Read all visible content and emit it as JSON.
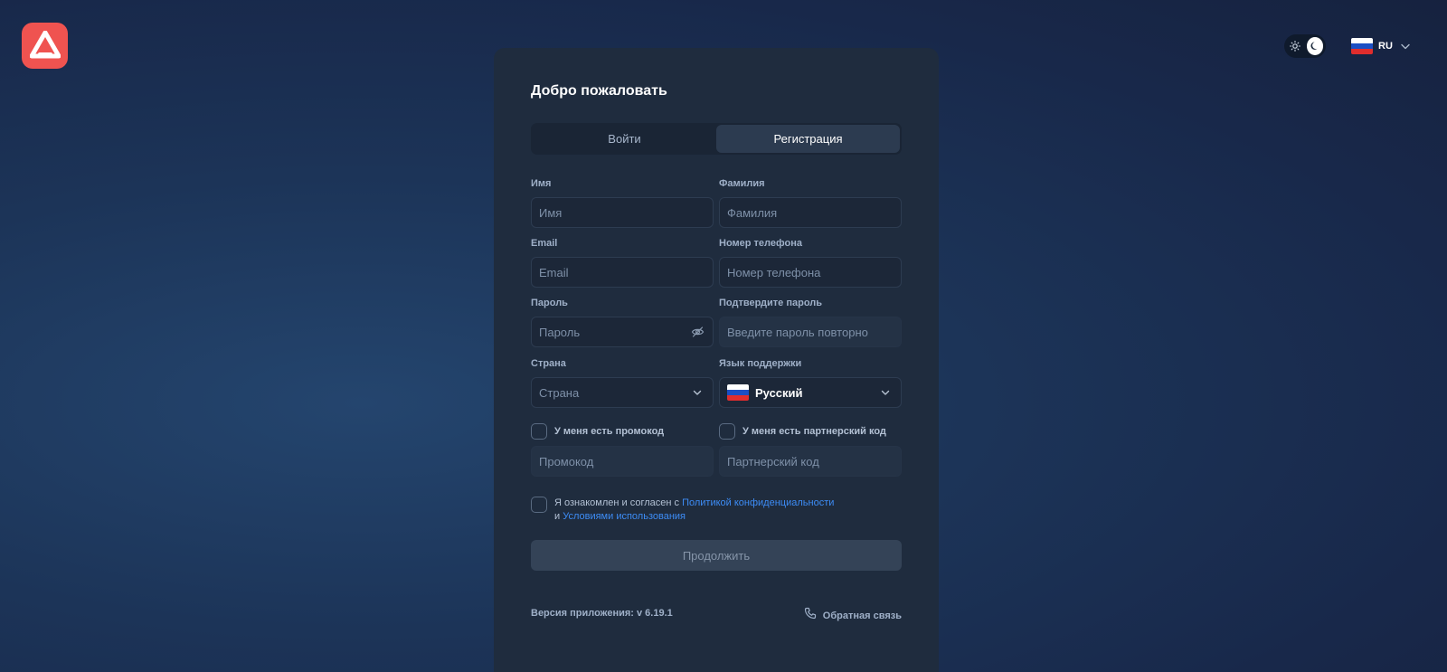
{
  "header": {
    "language_code": "RU",
    "icons": {
      "logo": "brand-logo",
      "theme_light": "sun-icon",
      "theme_dark": "moon-icon",
      "flag": "russia-flag-icon"
    }
  },
  "card": {
    "title": "Добро пожаловать",
    "tabs": [
      {
        "label": "Войти",
        "active": false
      },
      {
        "label": "Регистрация",
        "active": true
      }
    ],
    "fields": {
      "first_name": {
        "label": "Имя",
        "placeholder": "Имя"
      },
      "last_name": {
        "label": "Фамилия",
        "placeholder": "Фамилия"
      },
      "email": {
        "label": "Email",
        "placeholder": "Email"
      },
      "phone": {
        "label": "Номер телефона",
        "placeholder": "Номер телефона"
      },
      "password": {
        "label": "Пароль",
        "placeholder": "Пароль"
      },
      "confirm_password": {
        "label": "Подтвердите пароль",
        "placeholder": "Введите пароль повторно"
      },
      "country": {
        "label": "Страна",
        "placeholder": "Страна"
      },
      "support_language": {
        "label": "Язык поддержки",
        "value": "Русский"
      },
      "promo_code": {
        "checkbox_label": "У меня есть промокод",
        "placeholder": "Промокод",
        "checked": false
      },
      "partner_code": {
        "checkbox_label": "У меня есть партнерский код",
        "placeholder": "Партнерский код",
        "checked": false
      }
    },
    "consent": {
      "prefix": "Я ознакомлен и согласен с ",
      "privacy_link": "Политикой конфиденциальности",
      "connector": "и ",
      "terms_link": "Условиями использования",
      "checked": false
    },
    "submit_label": "Продолжить",
    "footer": {
      "version": "Версия приложения: v 6.19.1",
      "feedback_label": "Обратная связь"
    }
  },
  "colors": {
    "brand": "#ef5350",
    "link": "#3d8cf5",
    "card_bg": "#1f2c3e"
  }
}
